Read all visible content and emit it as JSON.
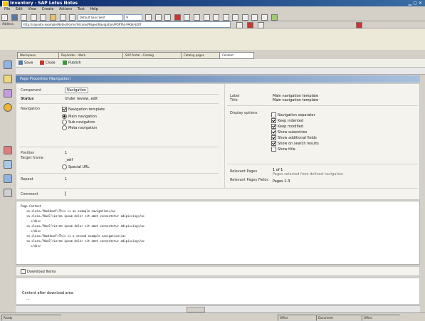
{
  "window": {
    "title": "Inventory - SAP Lotus Notes"
  },
  "menu": [
    "File",
    "Edit",
    "View",
    "Create",
    "Actions",
    "Text",
    "Help"
  ],
  "toolbar": {
    "font_select": "Default Sans Serif",
    "size_select": "9"
  },
  "address": {
    "label": "Address",
    "value": "http://sapnote.example/Notes/Forms/Intranet/Pages/Navigation/PORTAL-PAGE-EDIT"
  },
  "tabs": [
    "Workspace",
    "Replicator - Work",
    "SAP Portal - Catalog",
    "Catalog pages",
    "Content"
  ],
  "actions": {
    "save": "Save",
    "close": "Close",
    "publish": "Publish"
  },
  "section": {
    "title": "Page Properties (Navigation)"
  },
  "form": {
    "component_label": "Component",
    "component_value": "Navigation",
    "status_label": "Status",
    "status_value": "Under review, edit",
    "navigation_label": "Navigation",
    "nav_options": [
      "Navigation template",
      "Main navigation",
      "Sub navigation",
      "Meta navigation"
    ],
    "position_label": "Position",
    "position_value": "1",
    "target_label": "Target frame",
    "target_value": "_self",
    "special_url": "Special URL",
    "repeat_label": "Repeat",
    "repeat_value": "1",
    "label_label": "Label",
    "label_value": "Main navigation template",
    "title_label": "Title",
    "title_value": "Main navigation template",
    "display_options_label": "Display options",
    "display_options": [
      {
        "label": "Navigation separator",
        "checked": false
      },
      {
        "label": "Keep indented",
        "checked": true
      },
      {
        "label": "Keep modified",
        "checked": true
      },
      {
        "label": "Show subentries",
        "checked": true
      },
      {
        "label": "Show additional fields",
        "checked": true
      },
      {
        "label": "Show on search results",
        "checked": true
      },
      {
        "label": "Show title",
        "checked": false
      }
    ],
    "rel_pages_label": "Relevant Pages",
    "rel_pages_value": "1 of 1",
    "rel_pages_note": "Pages selected from defined navigation",
    "rel_pages2_label": "Relevant Pages Fields",
    "rel_pages2_value": "Pages 1-3",
    "comment_label": "Comment"
  },
  "code": {
    "header": "Page Content",
    "lines": [
      "<a class=\"NavHead\">This is an example navigation</a>",
      "<a class=\"NavS\">Lorem ipsum dolor sit amet consectetur adipiscing</a>",
      "</div>",
      "<a class=\"NavS\">Lorem ipsum dolor sit amet consectetur adipiscing</a>",
      "</div>",
      "<a class=\"NavHead\">This is a second example navigation</a>",
      "<a class=\"NavS\">Lorem ipsum dolor sit amet consectetur adipiscing</a>",
      "</div>"
    ]
  },
  "download": {
    "label": "Download Items"
  },
  "bottom": {
    "text": "Content after download area",
    "cursor": "..."
  },
  "status": {
    "left": "Ready",
    "mid1": "Office",
    "mid2": "Document",
    "right": "Office"
  },
  "colors": {
    "titlebar": "#0a246a",
    "section": "#5b7fb0",
    "chrome": "#d4d0c8"
  }
}
